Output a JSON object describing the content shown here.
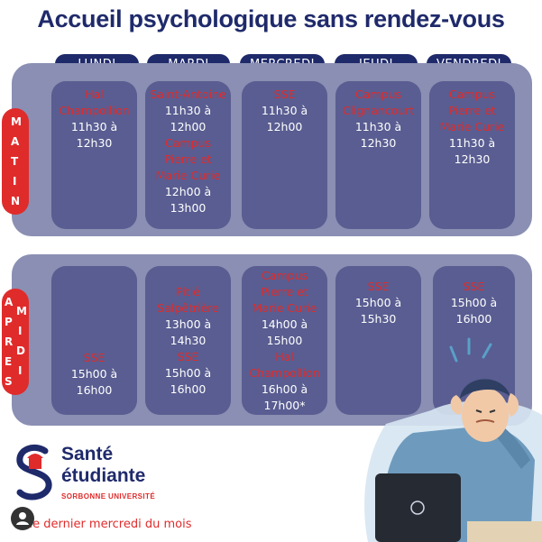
{
  "title": "Accueil psychologique sans rendez-vous",
  "days": [
    "LUNDI",
    "MARDI",
    "MERCREDI",
    "JEUDI",
    "VENDREDI"
  ],
  "side_labels": {
    "morning": [
      "M",
      "A",
      "T",
      "I",
      "N"
    ],
    "afternoon_col1": [
      "A",
      "P",
      "R",
      "E",
      "S"
    ],
    "afternoon_col2": [
      "M",
      "I",
      "D",
      "I"
    ]
  },
  "morning": [
    {
      "loc": "Hal Champollion",
      "time": [
        "11h30 à",
        "12h30"
      ]
    },
    {
      "loc": "Saint-Antoine",
      "time": [
        "11h30 à",
        "12h00"
      ],
      "loc2": "Campus Pierre et Marie Curie",
      "time2": [
        "12h00 à",
        "13h00"
      ]
    },
    {
      "loc": "SSE",
      "time": [
        "11h30 à",
        "12h00"
      ]
    },
    {
      "loc": "Campus Clignancourt",
      "time": [
        "11h30 à",
        "12h30"
      ]
    },
    {
      "loc": "Campus Pierre et Marie Curie",
      "time": [
        "11h30 à",
        "12h30"
      ]
    }
  ],
  "afternoon": [
    {
      "loc": "SSE",
      "time": [
        "15h00 à",
        "16h00"
      ]
    },
    {
      "loc": "Pitié Salpêtrière",
      "time": [
        "13h00 à",
        "14h30"
      ],
      "loc2": "SSE",
      "time2": [
        "15h00 à",
        "16h00"
      ]
    },
    {
      "loc": "Campus Pierre et Marie Curie",
      "time": [
        "14h00 à",
        "15h00"
      ],
      "loc2": "Hal Champollion",
      "time2": [
        "16h00 à",
        "17h00*"
      ]
    },
    {
      "loc": "SSE",
      "time": [
        "15h00 à",
        "15h30"
      ]
    },
    {
      "loc": "SSE",
      "time": [
        "15h00 à",
        "16h00"
      ]
    }
  ],
  "brand": {
    "line1": "Santé",
    "line2": "étudiante",
    "line3": "SORBONNE UNIVERSITÉ"
  },
  "footnote": "*le dernier mercredi du mois",
  "icons": {
    "logo": "sorbonne-s-logo-icon",
    "user": "user-avatar-icon",
    "illustration": "stressed-student-illustration"
  }
}
